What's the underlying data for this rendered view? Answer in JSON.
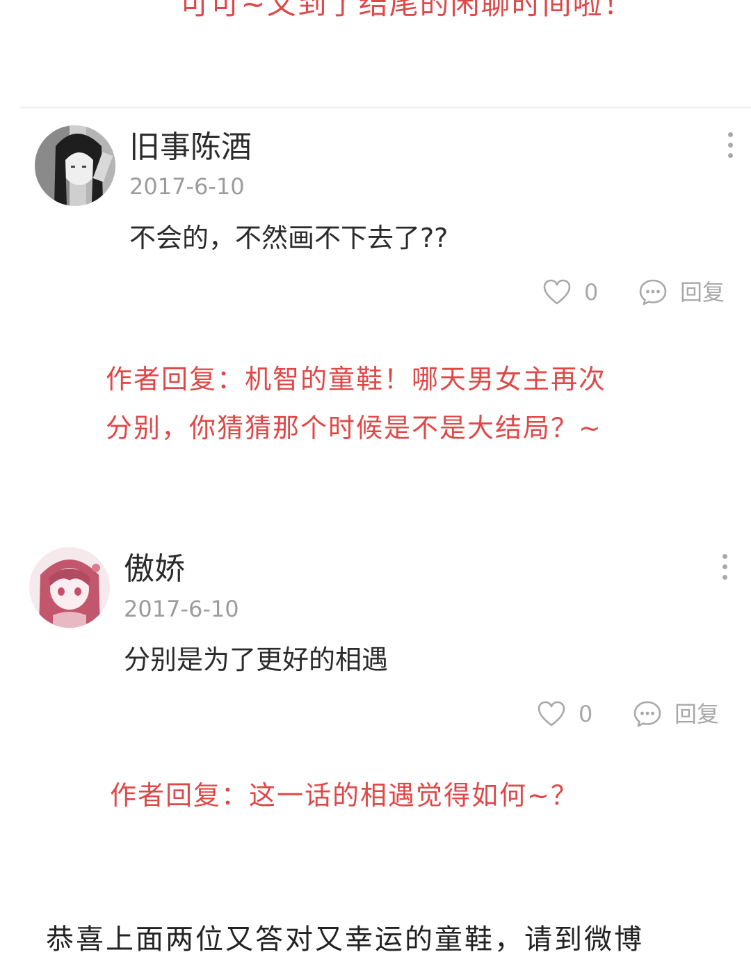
{
  "banner": "可可~又到了结尾的闲聊时间啦！",
  "comments": [
    {
      "username": "旧事陈酒",
      "date": "2017-6-10",
      "text": "不会的，不然画不下去了??",
      "likes": "0",
      "reply_label": "回复",
      "author_reply": [
        "作者回复：机智的童鞋！哪天男女主再次",
        "分别，你猜猜那个时候是不是大结局？~"
      ]
    },
    {
      "username": "傲娇",
      "date": "2017-6-10",
      "text": "分别是为了更好的相遇",
      "likes": "0",
      "reply_label": "回复",
      "author_reply": [
        "作者回复：这一话的相遇觉得如何~？"
      ]
    }
  ],
  "footer": "恭喜上面两位又答对又幸运的童鞋，请到微博",
  "colors": {
    "accent": "#e04848",
    "muted": "#a8a8a8",
    "text": "#2b2b2b"
  },
  "icons": {
    "like": "heart-outline-icon",
    "reply": "speech-bubble-icon",
    "more": "vertical-dots-icon"
  }
}
